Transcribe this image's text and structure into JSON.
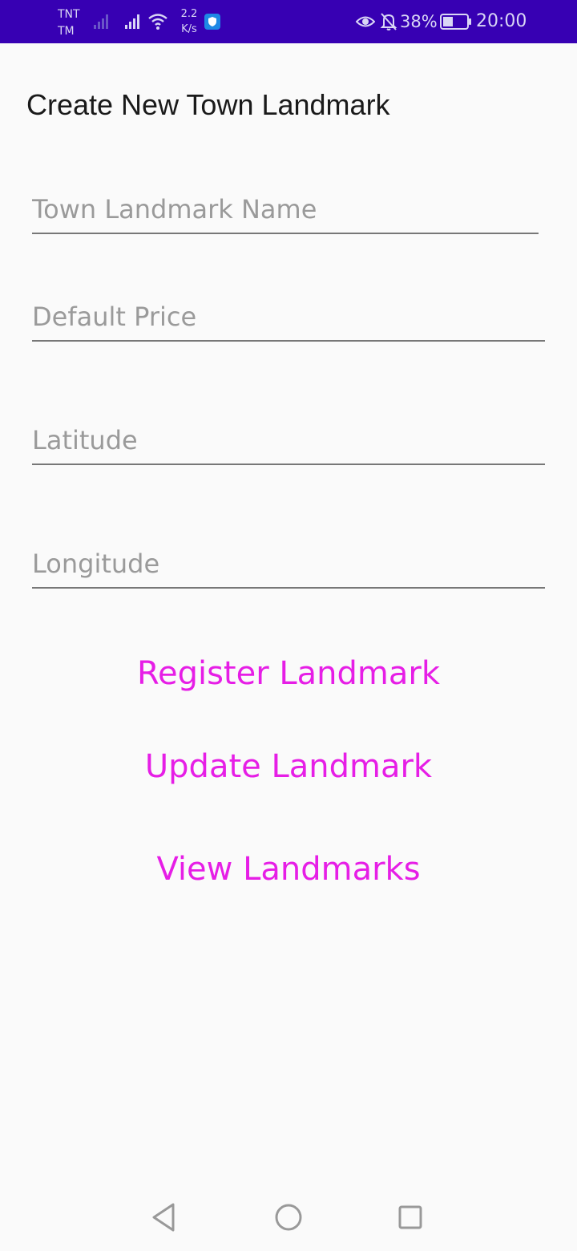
{
  "status_bar": {
    "carrier_line1": "TNT",
    "carrier_line2": "TM",
    "speed_value": "2.2",
    "speed_unit": "K/s",
    "battery_percent": "38%",
    "time": "20:00",
    "icons": [
      "signal-icon",
      "signal-icon",
      "wifi-icon",
      "shield-icon",
      "eye-icon",
      "bell-off-icon",
      "battery-icon"
    ],
    "background_color": "#3700b3"
  },
  "page": {
    "title": "Create New Town Landmark"
  },
  "form": {
    "name_placeholder": "Town Landmark Name",
    "price_placeholder": "Default Price",
    "latitude_placeholder": "Latitude",
    "longitude_placeholder": "Longitude"
  },
  "actions": {
    "register_label": "Register Landmark",
    "update_label": "Update Landmark",
    "view_label": "View Landmarks",
    "accent_color": "#e61ee6"
  },
  "nav_bar": {
    "icons": [
      "back-icon",
      "home-icon",
      "recents-icon"
    ]
  }
}
